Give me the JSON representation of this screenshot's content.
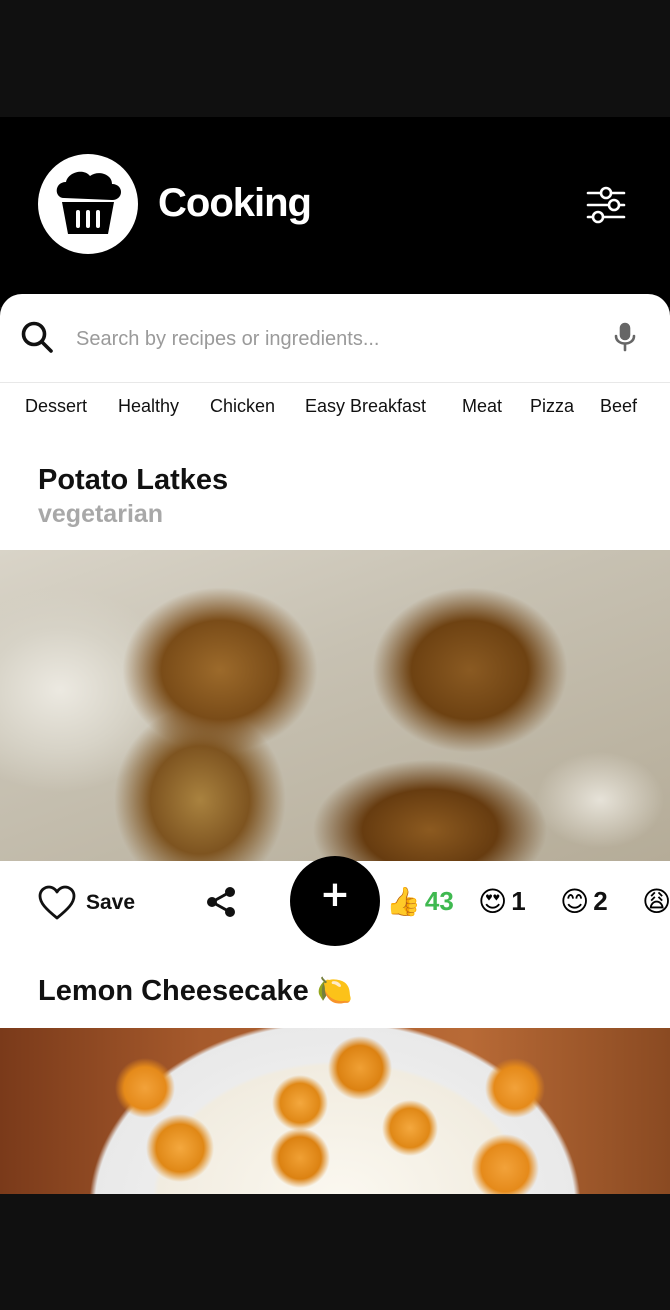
{
  "app": {
    "title": "Cooking"
  },
  "search": {
    "placeholder": "Search by recipes or ingredients..."
  },
  "categories": [
    "Dessert",
    "Healthy",
    "Chicken",
    "Easy Breakfast",
    "Meat",
    "Pizza",
    "Beef"
  ],
  "recipes": [
    {
      "title": "Potato Latkes",
      "subtitle": "vegetarian",
      "save_label": "Save",
      "reactions": [
        {
          "emoji": "👍",
          "count": "43",
          "color": "#3fb950"
        },
        {
          "emoji": "😍",
          "count": "1",
          "color": "#111111"
        },
        {
          "emoji": "😊",
          "count": "2",
          "color": "#111111"
        },
        {
          "emoji": "😩",
          "count": "",
          "color": "#111111"
        }
      ]
    },
    {
      "title": "Lemon Cheesecake 🍋"
    }
  ],
  "fab": {
    "label": "+"
  },
  "icons": {
    "logo": "muffin-icon",
    "filter": "sliders-icon",
    "search": "search-icon",
    "mic": "microphone-icon",
    "save": "heart-icon",
    "share": "share-icon",
    "react": "add-reaction-icon"
  }
}
